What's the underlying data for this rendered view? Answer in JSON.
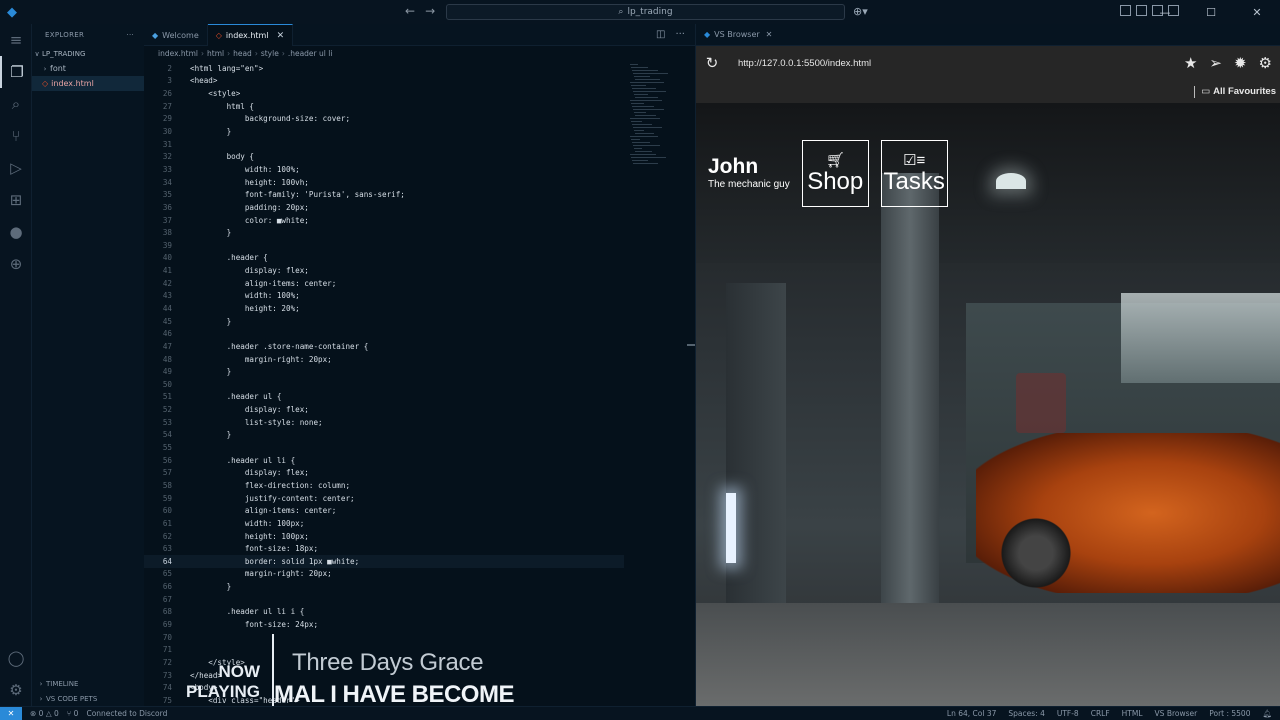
{
  "window": {
    "search_text": "lp_trading"
  },
  "explorer": {
    "title": "EXPLORER",
    "project": "LP_TRADING",
    "items": [
      {
        "label": "font",
        "type": "folder"
      },
      {
        "label": "index.html",
        "type": "file"
      }
    ],
    "bottom": [
      "TIMELINE",
      "VS CODE PETS"
    ]
  },
  "tabs": [
    {
      "label": "Welcome",
      "active": false
    },
    {
      "label": "index.html",
      "active": true
    }
  ],
  "breadcrumb": [
    "index.html",
    "html",
    "head",
    "style",
    ".header ul li"
  ],
  "code_lines": [
    {
      "n": "2",
      "t": "<html lang=\"en\">"
    },
    {
      "n": "3",
      "t": "<head>"
    },
    {
      "n": "26",
      "t": "    <style>"
    },
    {
      "n": "27",
      "t": "        html {"
    },
    {
      "n": "29",
      "t": "            background-size: cover;"
    },
    {
      "n": "30",
      "t": "        }"
    },
    {
      "n": "31",
      "t": ""
    },
    {
      "n": "32",
      "t": "        body {"
    },
    {
      "n": "33",
      "t": "            width: 100%;"
    },
    {
      "n": "34",
      "t": "            height: 100vh;"
    },
    {
      "n": "35",
      "t": "            font-family: 'Purista', sans-serif;"
    },
    {
      "n": "36",
      "t": "            padding: 20px;"
    },
    {
      "n": "37",
      "t": "            color: ■white;"
    },
    {
      "n": "38",
      "t": "        }"
    },
    {
      "n": "39",
      "t": ""
    },
    {
      "n": "40",
      "t": "        .header {"
    },
    {
      "n": "41",
      "t": "            display: flex;"
    },
    {
      "n": "42",
      "t": "            align-items: center;"
    },
    {
      "n": "43",
      "t": "            width: 100%;"
    },
    {
      "n": "44",
      "t": "            height: 20%;"
    },
    {
      "n": "45",
      "t": "        }"
    },
    {
      "n": "46",
      "t": ""
    },
    {
      "n": "47",
      "t": "        .header .store-name-container {"
    },
    {
      "n": "48",
      "t": "            margin-right: 20px;"
    },
    {
      "n": "49",
      "t": "        }"
    },
    {
      "n": "50",
      "t": ""
    },
    {
      "n": "51",
      "t": "        .header ul {"
    },
    {
      "n": "52",
      "t": "            display: flex;"
    },
    {
      "n": "53",
      "t": "            list-style: none;"
    },
    {
      "n": "54",
      "t": "        }"
    },
    {
      "n": "55",
      "t": ""
    },
    {
      "n": "56",
      "t": "        .header ul li {"
    },
    {
      "n": "57",
      "t": "            display: flex;"
    },
    {
      "n": "58",
      "t": "            flex-direction: column;"
    },
    {
      "n": "59",
      "t": "            justify-content: center;"
    },
    {
      "n": "60",
      "t": "            align-items: center;"
    },
    {
      "n": "61",
      "t": "            width: 100px;"
    },
    {
      "n": "62",
      "t": "            height: 100px;"
    },
    {
      "n": "63",
      "t": "            font-size: 18px;"
    },
    {
      "n": "64",
      "t": "            border: solid 1px ■white;"
    },
    {
      "n": "65",
      "t": "            margin-right: 20px;"
    },
    {
      "n": "66",
      "t": "        }"
    },
    {
      "n": "67",
      "t": ""
    },
    {
      "n": "68",
      "t": "        .header ul li i {"
    },
    {
      "n": "69",
      "t": "            font-size: 24px;"
    },
    {
      "n": "70",
      "t": ""
    },
    {
      "n": "71",
      "t": ""
    },
    {
      "n": "72",
      "t": "    </style>"
    },
    {
      "n": "73",
      "t": "</head>"
    },
    {
      "n": "74",
      "t": "<body>"
    },
    {
      "n": "75",
      "t": "    <div class=\"header\">"
    }
  ],
  "current_line": "64",
  "now_playing": {
    "label": "NOW PLAYING",
    "label_line1": "NOW",
    "label_line2": "PLAYING",
    "artist": "Three Days Grace",
    "song": "MAL I HAVE BECOME"
  },
  "browser": {
    "tab_label": "VS Browser",
    "url": "http://127.0.0.1:5500/index.html",
    "favourites": "All Favourites"
  },
  "site": {
    "store_name": "John",
    "store_sub": "The mechanic guy",
    "nav": [
      {
        "label": "Shop",
        "icon": "cart-icon"
      },
      {
        "label": "Tasks",
        "icon": "tasks-icon"
      }
    ]
  },
  "statusbar": {
    "errors": "0",
    "warnings": "0",
    "ports": "0",
    "discord": "Connected to Discord",
    "position": "Ln 64, Col 37",
    "spaces": "Spaces: 4",
    "encoding": "UTF-8",
    "eol": "CRLF",
    "language": "HTML",
    "browser": "VS Browser",
    "port": "Port : 5500"
  },
  "colors": {
    "accent": "#2a8ad8",
    "editor_bg": "#05111b",
    "html_icon": "#e44d26"
  }
}
